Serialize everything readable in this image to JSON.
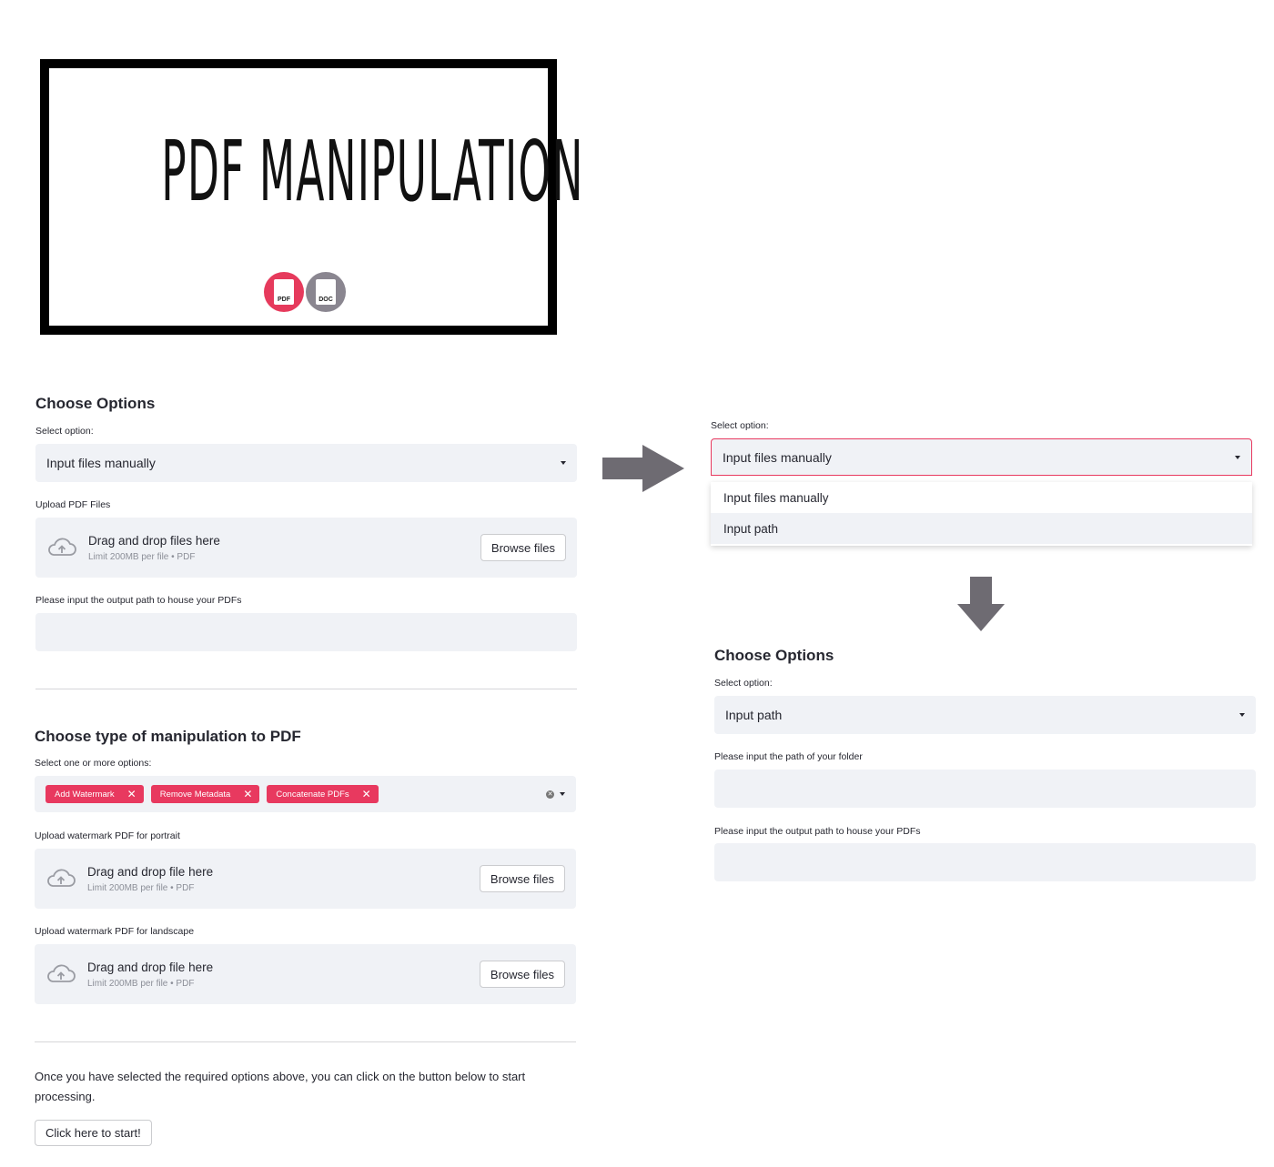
{
  "banner": {
    "title": "PDF MANIPULATION",
    "icons": [
      {
        "name": "pdf-icon",
        "label": "PDF",
        "color": "#e63a5c"
      },
      {
        "name": "doc-icon",
        "label": "DOC",
        "color": "#8a8690"
      }
    ]
  },
  "left": {
    "options_heading": "Choose Options",
    "select_label": "Select option:",
    "select_value": "Input files manually",
    "upload_label": "Upload PDF Files",
    "upload_main": "Drag and drop files here",
    "upload_sub": "Limit 200MB per file • PDF",
    "browse_label": "Browse files",
    "output_label": "Please input the output path to house your PDFs",
    "manip_heading": "Choose type of manipulation to PDF",
    "multi_label": "Select one or more options:",
    "tags": [
      "Add Watermark",
      "Remove Metadata",
      "Concatenate PDFs"
    ],
    "portrait_label": "Upload watermark PDF for portrait",
    "landscape_label": "Upload watermark PDF for landscape",
    "drop_single": "Drag and drop file here",
    "start_text": "Once you have selected the required options above, you can click on the button below to start processing.",
    "start_button": "Click here to start!"
  },
  "dropdown": {
    "label": "Select option:",
    "value": "Input files manually",
    "options": [
      "Input files manually",
      "Input path"
    ]
  },
  "right": {
    "options_heading": "Choose Options",
    "select_label": "Select option:",
    "select_value": "Input path",
    "folder_label": "Please input the path of your folder",
    "output_label": "Please input the output path to house your PDFs"
  },
  "colors": {
    "accent": "#e8395f",
    "arrow": "#6e6b72",
    "input_bg": "#f0f2f6"
  }
}
